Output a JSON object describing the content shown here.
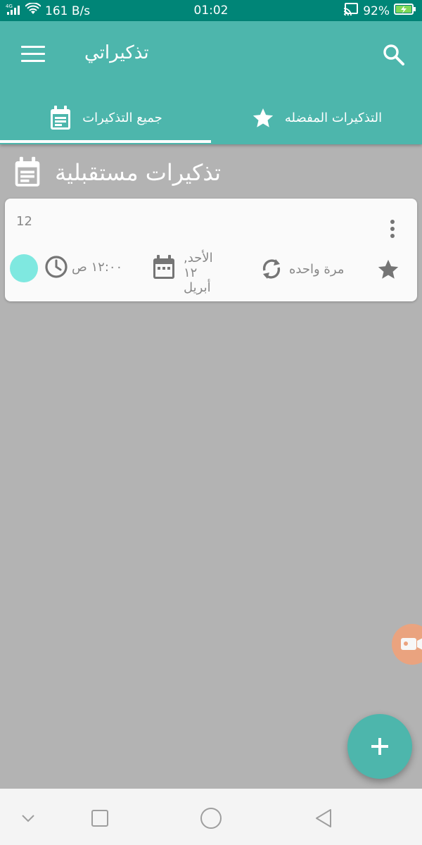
{
  "status_bar": {
    "network": "4G",
    "speed": "161 B/s",
    "time": "01:02",
    "battery": "92%"
  },
  "app_bar": {
    "title": "تذكيراتي",
    "menu_icon": "menu-icon",
    "search_icon": "search-icon"
  },
  "tabs": [
    {
      "label": "جميع التذكيرات",
      "icon": "calendar-note-icon",
      "selected": true
    },
    {
      "label": "التذكيرات المفضله",
      "icon": "star-icon",
      "selected": false
    }
  ],
  "section": {
    "title": "تذكيرات مستقبلية",
    "icon": "calendar-note-icon"
  },
  "reminder": {
    "title": "12",
    "time": "١٢:٠٠ ص",
    "date_line1": "الأحد, ١٢",
    "date_line2": "أبريل",
    "repeat": "مرة واحده",
    "color": "#7fe8e0"
  },
  "colors": {
    "primary": "#4db6ac",
    "status_bar": "#008577",
    "background": "#b3b3b3"
  }
}
